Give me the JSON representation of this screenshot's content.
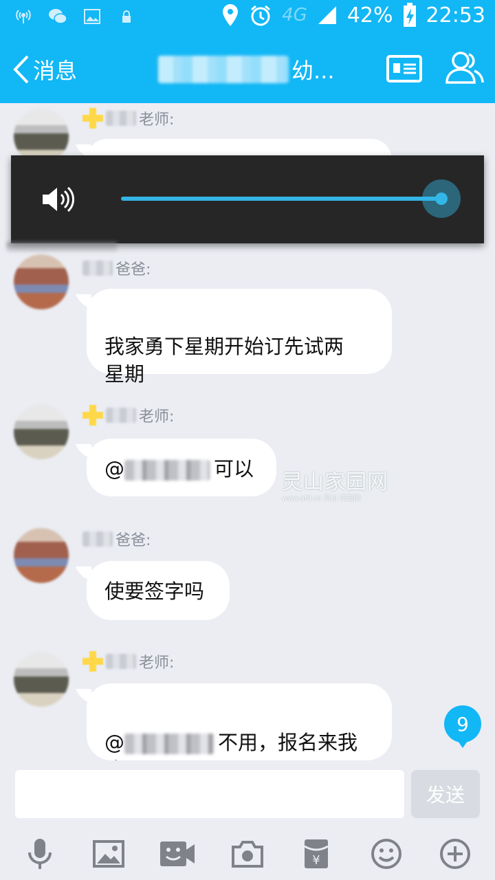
{
  "status_bar": {
    "battery": "42%",
    "time": "22:53",
    "network": "4G"
  },
  "header": {
    "back_label": "消息",
    "title_suffix": "幼..."
  },
  "messages": [
    {
      "sender_suffix": "老师:",
      "role": "teacher",
      "text": ""
    },
    {
      "sender_suffix": "爸爸:",
      "role": "parent",
      "text": "我家勇下星期开始订先试两\n星期"
    },
    {
      "sender_suffix": "老师:",
      "role": "teacher",
      "mention": "@",
      "text": "可以"
    },
    {
      "sender_suffix": "爸爸:",
      "role": "parent",
      "text": "使要签字吗"
    },
    {
      "sender_suffix": "老师:",
      "role": "teacher",
      "mention": "@",
      "text": "不用，报名来我\n这可以了"
    }
  ],
  "volume": {
    "level_percent": 100
  },
  "watermark": {
    "title": "灵山家园网",
    "subtitle": "www.af0.cn 灵山 家园网"
  },
  "unread_count": "9",
  "input": {
    "value": "",
    "send_label": "发送"
  },
  "toolbar": [
    "mic-icon",
    "image-icon",
    "video-chat-icon",
    "camera-icon",
    "red-packet-icon",
    "emoji-icon",
    "plus-icon"
  ],
  "colors": {
    "brand": "#12b7f5",
    "slider": "#33b5e5",
    "background": "#ebedf3"
  }
}
